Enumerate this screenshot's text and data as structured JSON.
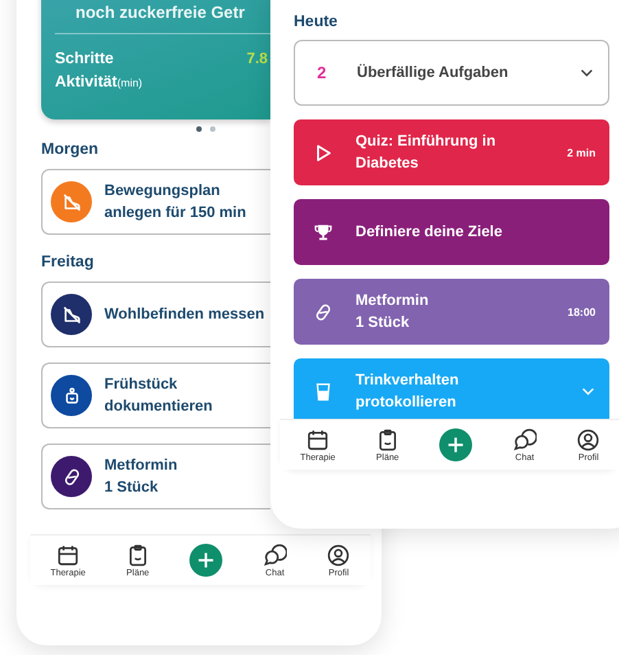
{
  "left_phone": {
    "summary_card": {
      "headline": "noch zuckerfreie Getr",
      "rows": [
        {
          "label": "Schritte",
          "value": "7.8"
        },
        {
          "label": "Aktivität",
          "unit": "(min)"
        }
      ]
    },
    "pager_dots": [
      {
        "selected": true
      },
      {
        "selected": false
      }
    ],
    "sections": [
      {
        "heading": "Morgen",
        "tasks": [
          {
            "kind": "activity",
            "title": "Bewegungsplan\nanlegen für 150 min",
            "color": "#f47a20"
          }
        ]
      },
      {
        "heading": "Freitag",
        "tasks": [
          {
            "kind": "measure",
            "title": "Wohlbefinden messen",
            "color": "#1f2f6b"
          },
          {
            "kind": "meal",
            "title": "Frühstück\ndokumentieren",
            "color": "#0d4aa0"
          },
          {
            "kind": "medication",
            "title": "Metformin\n1 Stück",
            "color": "#3d1a6e"
          }
        ]
      }
    ],
    "nav": [
      {
        "kind": "calendar",
        "label": "Therapie"
      },
      {
        "kind": "clipboard",
        "label": "Pläne"
      },
      {
        "kind": "add"
      },
      {
        "kind": "chat",
        "label": "Chat"
      },
      {
        "kind": "profile",
        "label": "Profil"
      }
    ]
  },
  "right_phone": {
    "heading": "Heute",
    "overdue": {
      "count": "2",
      "label": "Überfällige Aufgaben"
    },
    "tasks": [
      {
        "kind": "quiz",
        "title": "Quiz: Einführung in\nDiabetes",
        "meta": "2 min",
        "color": "#e0264a"
      },
      {
        "kind": "goal",
        "title": "Definiere deine Ziele",
        "color": "#8a1f7a"
      },
      {
        "kind": "medication",
        "title": "Metformin\n1 Stück",
        "meta": "18:00",
        "color": "#8263b0"
      },
      {
        "kind": "drink",
        "title": "Trinkverhalten\nprotokollieren",
        "expandable": true,
        "color": "#17a9f5"
      }
    ],
    "nav": [
      {
        "kind": "calendar",
        "label": "Therapie"
      },
      {
        "kind": "clipboard",
        "label": "Pläne"
      },
      {
        "kind": "add"
      },
      {
        "kind": "chat",
        "label": "Chat"
      },
      {
        "kind": "profile",
        "label": "Profil"
      }
    ]
  }
}
